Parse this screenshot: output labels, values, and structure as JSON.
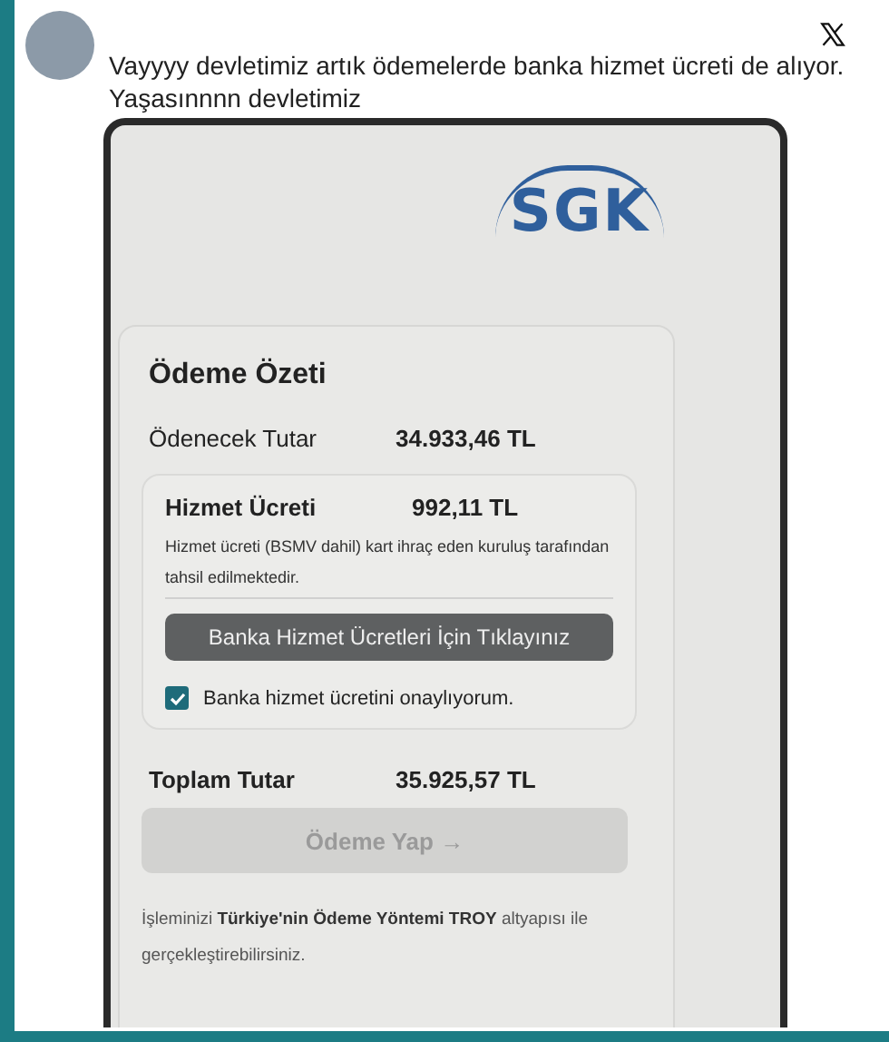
{
  "post": {
    "text_lines": [
      "Vayyyy devletimiz artık ödemelerde banka hizmet ücreti de alıyor.",
      "Yaşasınnnn devletimiz"
    ]
  },
  "screenshot": {
    "logo": "SGK",
    "card": {
      "title": "Ödeme Özeti",
      "amount": {
        "label": "Ödenecek Tutar",
        "value": "34.933,46 TL"
      },
      "fee": {
        "label": "Hizmet Ücreti",
        "value": "992,11 TL",
        "note": "Hizmet ücreti (BSMV dahil) kart ihraç eden kuruluş tarafından tahsil edilmektedir.",
        "link_button": "Banka Hizmet Ücretleri İçin Tıklayınız",
        "consent": {
          "label": "Banka hizmet ücretini onaylıyorum.",
          "checked": true
        }
      },
      "total": {
        "label": "Toplam Tutar",
        "value": "35.925,57 TL"
      },
      "pay_button": {
        "label": "Ödeme Yap →",
        "disabled": true
      }
    },
    "footer": "İşleminizi **Türkiye'nin Ödeme Yöntemi TROY** altyapısı ile gerçekleştirebilirsiniz."
  }
}
